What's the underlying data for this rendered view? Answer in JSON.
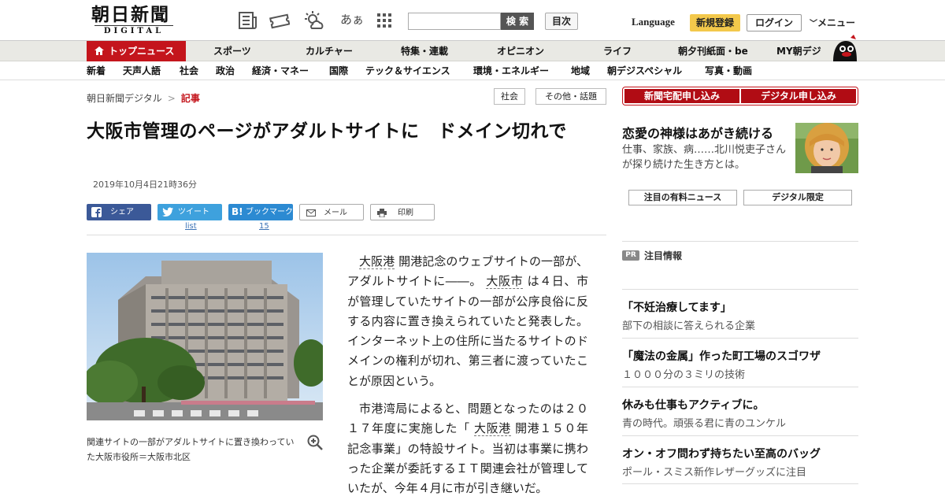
{
  "header": {
    "logo_main": "朝日新聞",
    "logo_sub": "DIGITAL",
    "icons": [
      "newspaper-icon",
      "ticket-icon",
      "weather-icon",
      "font-size-icon",
      "grid-icon"
    ],
    "font_size_label": "あぁ",
    "search_placeholder": "",
    "search_button": "検 索",
    "contents_button": "目次",
    "language": "Language",
    "register_button": "新規登録",
    "login_button": "ログイン",
    "menu_button": "メニュー"
  },
  "nav_primary": [
    "トップニュース",
    "スポーツ",
    "カルチャー",
    "特集・連載",
    "オピニオン",
    "ライフ",
    "朝夕刊紙面・be",
    "MY朝デジ"
  ],
  "nav_secondary": [
    "新着",
    "天声人語",
    "社会",
    "政治",
    "経済・マネー",
    "国際",
    "テック＆サイエンス",
    "環境・エネルギー",
    "地域",
    "朝デジスペシャル",
    "写真・動画"
  ],
  "breadcrumb": {
    "home": "朝日新聞デジタル",
    "separator": ">",
    "current": "記事"
  },
  "tags": [
    "社会",
    "その他・話題"
  ],
  "article": {
    "headline": "大阪市管理のページがアダルトサイトに　ドメイン切れで",
    "date": "2019年10月4日21時36分",
    "share": {
      "facebook": "シェア",
      "twitter": "ツイート",
      "twitter_count": "list",
      "hatena": "ブックマーク",
      "hatena_badge": "B!",
      "hatena_count": "15",
      "mail": "メール",
      "print": "印刷"
    },
    "caption": "関連サイトの一部がアダルトサイトに置き換わっていた大阪市役所＝大阪市北区",
    "p1_kw1": "大阪港",
    "p1_a": "開港記念のウェブサイトの一部が、アダルトサイトに――。",
    "p1_kw2": "大阪市",
    "p1_b": "は４日、市が管理していたサイトの一部が公序良俗に反する内容に置き換えられていたと発表した。インターネット上の住所に当たるサイトのドメインの権利が切れ、第三者に渡っていたことが原因という。",
    "p2_a": "市港湾局によると、問題となったのは２０１７年度に実施した「",
    "p2_kw": "大阪港",
    "p2_b": "開港１５０年記念事業」の特設サイト。当初は事業に携わった企業が委託するＩＴ関連会社が管理していたが、今年４月に市が引き継いだ。"
  },
  "sidebar": {
    "subscribe_paper": "新聞宅配申し込み",
    "subscribe_digital": "デジタル申し込み",
    "promo_title": "恋愛の神様はあがき続ける",
    "promo_desc": "仕事、家族、病……北川悦吏子さんが探り続けた生き方とは。",
    "pill_news": "注目の有料ニュース",
    "pill_digital": "デジタル限定",
    "pr_badge": "PR",
    "pr_title": "注目情報",
    "pr_items": [
      {
        "title": "「不妊治療してます」",
        "desc": "部下の相談に答えられる企業"
      },
      {
        "title": "「魔法の金属」作った町工場のスゴワザ",
        "desc": "１０００分の３ミリの技術"
      },
      {
        "title": "休みも仕事もアクティブに。",
        "desc": "青の時代。頑張る君に青のユンケル"
      },
      {
        "title": "オン・オフ問わず持ちたい至高のバッグ",
        "desc": "ポール・スミス新作レザーグッズに注目"
      }
    ]
  },
  "colors": {
    "brand_red": "#c4151c",
    "facebook": "#3b5998",
    "twitter": "#3ea1dd",
    "hatena": "#2c8ad2",
    "register": "#f3c84b"
  }
}
